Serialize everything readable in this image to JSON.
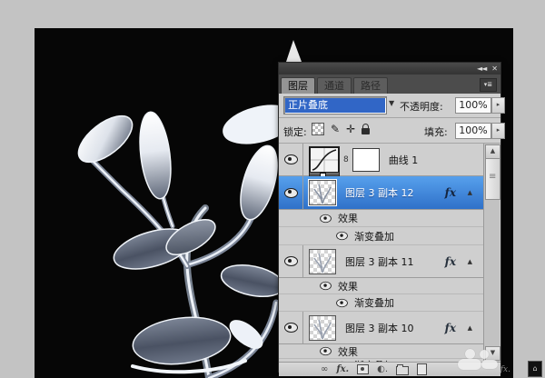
{
  "colors": {
    "workspace_gray": "#c3c3c3",
    "canvas_black": "#060606",
    "selection_blue": "#3166c6",
    "selected_row_blue": "#3b7fd8",
    "panel_gray": "#cfcfcf"
  },
  "panel": {
    "header": {
      "collapse_icon": "◄◄",
      "close_icon": "✕",
      "menu_icon": "▾≣"
    },
    "tabs": [
      {
        "label": "图层"
      },
      {
        "label": "通道"
      },
      {
        "label": "路径"
      }
    ],
    "blend_row": {
      "mode": "正片叠底",
      "dropdown_arrow": "▼",
      "opacity_label": "不透明度:",
      "opacity_value": "100%",
      "spin_icon": "▸"
    },
    "lock_row": {
      "lock_label": "锁定:",
      "brush_icon": "✎",
      "move_icon": "✛",
      "fill_label": "填充:",
      "fill_value": "100%",
      "spin_icon": "▸"
    },
    "layer_list": {
      "adjustment": {
        "name": "曲线 1",
        "clip_icon": "8"
      },
      "fx_badge": "fx",
      "expand_icon": "▲",
      "effects_label": "效果",
      "gradient_overlay_label": "渐变叠加",
      "rows": [
        {
          "name": "图层 3 副本 12",
          "selected": true
        },
        {
          "name": "图层 3 副本 11",
          "selected": false
        },
        {
          "name": "图层 3 副本 10",
          "selected": false
        }
      ]
    },
    "scrollbar": {
      "up_icon": "▲",
      "down_icon": "▼"
    },
    "bottom_bar": {
      "link_icon": "∞",
      "fx_icon": "fx.",
      "adjust_icon": "◐."
    }
  }
}
